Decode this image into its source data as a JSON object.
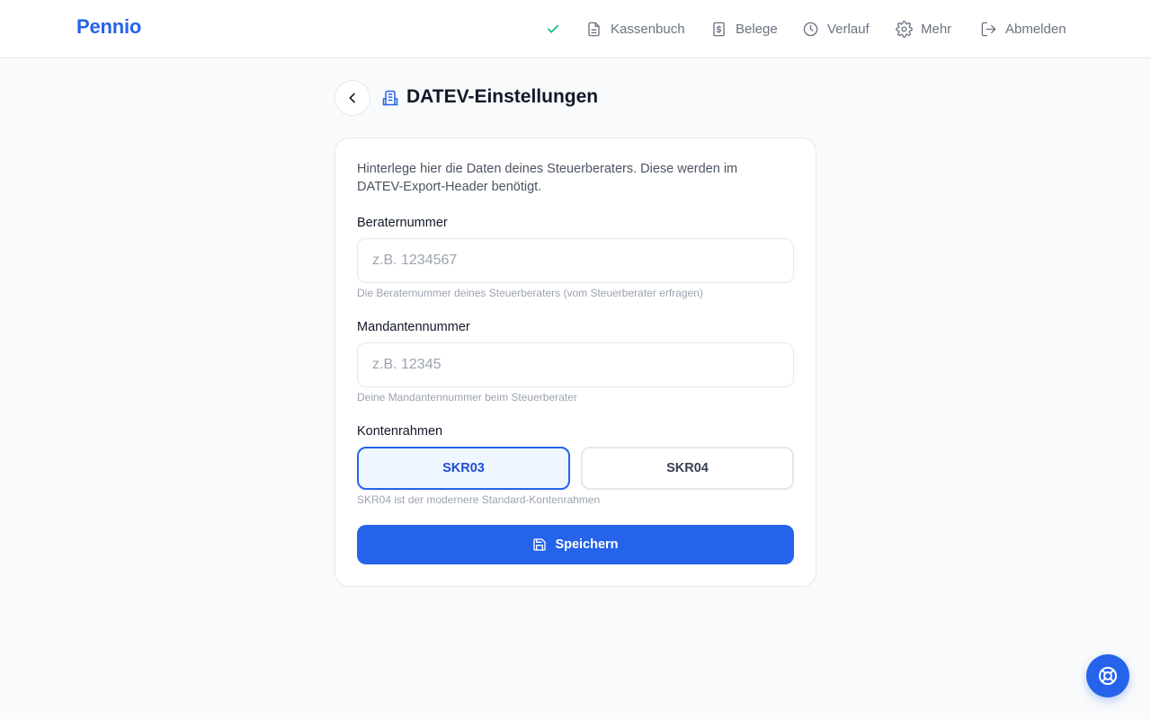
{
  "app": {
    "logo": "Pennio"
  },
  "nav": {
    "status_icon": "check-icon",
    "items": [
      {
        "label": "Kassenbuch",
        "icon": "document-icon"
      },
      {
        "label": "Belege",
        "icon": "receipt-icon"
      },
      {
        "label": "Verlauf",
        "icon": "clock-icon"
      },
      {
        "label": "Mehr",
        "icon": "gear-icon"
      },
      {
        "label": "Abmelden",
        "icon": "logout-icon"
      }
    ]
  },
  "page": {
    "title": "DATEV-Einstellungen",
    "title_icon": "building-icon",
    "back_icon": "chevron-left-icon"
  },
  "form": {
    "intro": "Hinterlege hier die Daten deines Steuerberaters. Diese werden im DATEV-Export-Header benötigt.",
    "berater": {
      "label": "Beraternummer",
      "placeholder": "z.B. 1234567",
      "value": "",
      "hint": "Die Beraternummer deines Steuerberaters (vom Steuerberater erfragen)"
    },
    "mandant": {
      "label": "Mandantennummer",
      "placeholder": "z.B. 12345",
      "value": "",
      "hint": "Deine Mandantennummer beim Steuerberater"
    },
    "kontenrahmen": {
      "label": "Kontenrahmen",
      "options": [
        "SKR03",
        "SKR04"
      ],
      "selected": "SKR03",
      "hint": "SKR04 ist der modernere Standard-Kontenrahmen"
    },
    "save_label": "Speichern",
    "save_icon": "save-icon"
  },
  "help": {
    "icon": "lifebuoy-icon"
  },
  "colors": {
    "accent": "#2563eb",
    "background": "#f9fafb",
    "success": "#10b981"
  }
}
